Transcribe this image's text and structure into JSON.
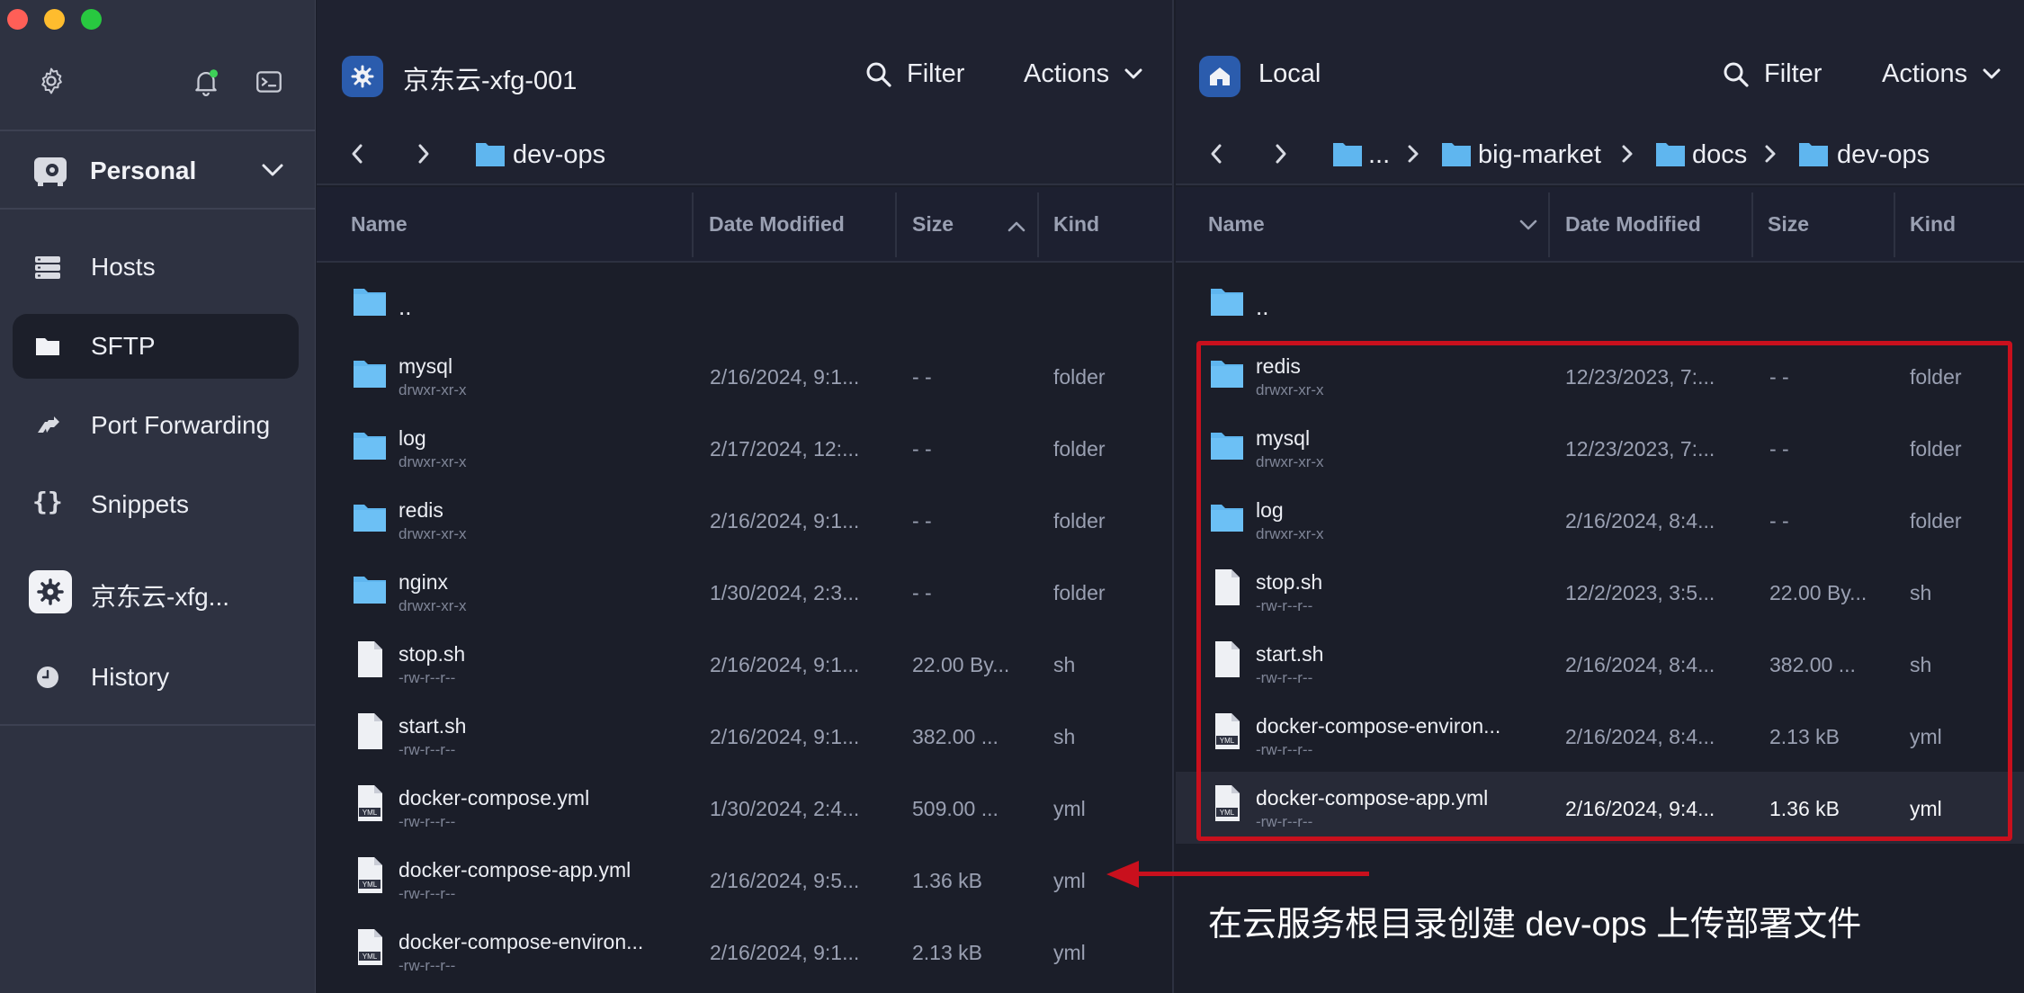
{
  "sidebar": {
    "vault_label": "Personal",
    "items": [
      {
        "label": "Hosts",
        "icon": "hosts-icon"
      },
      {
        "label": "SFTP",
        "icon": "folder-icon"
      },
      {
        "label": "Port Forwarding",
        "icon": "port-forwarding-icon"
      },
      {
        "label": "Snippets",
        "icon": "braces-icon"
      },
      {
        "label": "京东云-xfg...",
        "icon": "host-gear-icon"
      },
      {
        "label": "History",
        "icon": "clock-icon"
      }
    ],
    "active_item": "SFTP"
  },
  "left_pane": {
    "host_title": "京东云-xfg-001",
    "filter_label": "Filter",
    "actions_label": "Actions",
    "breadcrumb": [
      "dev-ops"
    ],
    "columns": [
      "Name",
      "Date Modified",
      "Size",
      "Kind"
    ],
    "rows": [
      {
        "name": "..",
        "perm": "",
        "date": "",
        "size": "",
        "kind": "",
        "type": "folder"
      },
      {
        "name": "mysql",
        "perm": "drwxr-xr-x",
        "date": "2/16/2024, 9:1...",
        "size": "- -",
        "kind": "folder",
        "type": "folder"
      },
      {
        "name": "log",
        "perm": "drwxr-xr-x",
        "date": "2/17/2024, 12:...",
        "size": "- -",
        "kind": "folder",
        "type": "folder"
      },
      {
        "name": "redis",
        "perm": "drwxr-xr-x",
        "date": "2/16/2024, 9:1...",
        "size": "- -",
        "kind": "folder",
        "type": "folder"
      },
      {
        "name": "nginx",
        "perm": "drwxr-xr-x",
        "date": "1/30/2024, 2:3...",
        "size": "- -",
        "kind": "folder",
        "type": "folder"
      },
      {
        "name": "stop.sh",
        "perm": "-rw-r--r--",
        "date": "2/16/2024, 9:1...",
        "size": "22.00 By...",
        "kind": "sh",
        "type": "file"
      },
      {
        "name": "start.sh",
        "perm": "-rw-r--r--",
        "date": "2/16/2024, 9:1...",
        "size": "382.00 ...",
        "kind": "sh",
        "type": "file"
      },
      {
        "name": "docker-compose.yml",
        "perm": "-rw-r--r--",
        "date": "1/30/2024, 2:4...",
        "size": "509.00 ...",
        "kind": "yml",
        "type": "yml"
      },
      {
        "name": "docker-compose-app.yml",
        "perm": "-rw-r--r--",
        "date": "2/16/2024, 9:5...",
        "size": "1.36 kB",
        "kind": "yml",
        "type": "yml"
      },
      {
        "name": "docker-compose-environ...",
        "perm": "-rw-r--r--",
        "date": "2/16/2024, 9:1...",
        "size": "2.13 kB",
        "kind": "yml",
        "type": "yml"
      }
    ]
  },
  "right_pane": {
    "host_title": "Local",
    "filter_label": "Filter",
    "actions_label": "Actions",
    "breadcrumb": [
      "...",
      "big-market",
      "docs",
      "dev-ops"
    ],
    "columns": [
      "Name",
      "Date Modified",
      "Size",
      "Kind"
    ],
    "rows": [
      {
        "name": "..",
        "perm": "",
        "date": "",
        "size": "",
        "kind": "",
        "type": "folder"
      },
      {
        "name": "redis",
        "perm": "drwxr-xr-x",
        "date": "12/23/2023, 7:...",
        "size": "- -",
        "kind": "folder",
        "type": "folder"
      },
      {
        "name": "mysql",
        "perm": "drwxr-xr-x",
        "date": "12/23/2023, 7:...",
        "size": "- -",
        "kind": "folder",
        "type": "folder"
      },
      {
        "name": "log",
        "perm": "drwxr-xr-x",
        "date": "2/16/2024, 8:4...",
        "size": "- -",
        "kind": "folder",
        "type": "folder"
      },
      {
        "name": "stop.sh",
        "perm": "-rw-r--r--",
        "date": "12/2/2023, 3:5...",
        "size": "22.00 By...",
        "kind": "sh",
        "type": "file"
      },
      {
        "name": "start.sh",
        "perm": "-rw-r--r--",
        "date": "2/16/2024, 8:4...",
        "size": "382.00 ...",
        "kind": "sh",
        "type": "file"
      },
      {
        "name": "docker-compose-environ...",
        "perm": "-rw-r--r--",
        "date": "2/16/2024, 8:4...",
        "size": "2.13 kB",
        "kind": "yml",
        "type": "yml"
      },
      {
        "name": "docker-compose-app.yml",
        "perm": "-rw-r--r--",
        "date": "2/16/2024, 9:4...",
        "size": "1.36 kB",
        "kind": "yml",
        "type": "yml"
      }
    ],
    "selected_row": 7
  },
  "annotation": {
    "text": "在云服务根目录创建 dev-ops 上传部署文件",
    "color": "#c9101d"
  },
  "colors": {
    "sidebar_bg": "#2e3241",
    "pane_bg": "#1b1e29",
    "folder": "#5fb6ef",
    "accent_blue": "#2b5cad",
    "notification_dot": "#3ed158"
  }
}
